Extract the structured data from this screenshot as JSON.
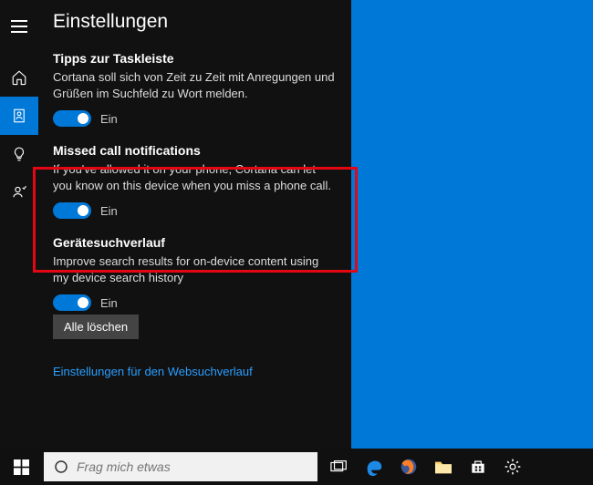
{
  "panel": {
    "title": "Einstellungen",
    "sections": [
      {
        "title": "Tipps zur Taskleiste",
        "desc": "Cortana soll sich von Zeit zu Zeit mit Anregungen und Grüßen im Suchfeld zu Wort melden.",
        "toggle_label": "Ein"
      },
      {
        "title": "Missed call notifications",
        "desc": "If you've allowed it on your phone, Cortana can let you know on this device when you miss a phone call.",
        "toggle_label": "Ein"
      },
      {
        "title": "Gerätesuchverlauf",
        "desc": "Improve search results for on-device content using my device search history",
        "toggle_label": "Ein"
      }
    ],
    "clear_button": "Alle löschen",
    "link": "Einstellungen für den Websuchverlauf"
  },
  "search": {
    "placeholder": "Frag mich etwas"
  }
}
